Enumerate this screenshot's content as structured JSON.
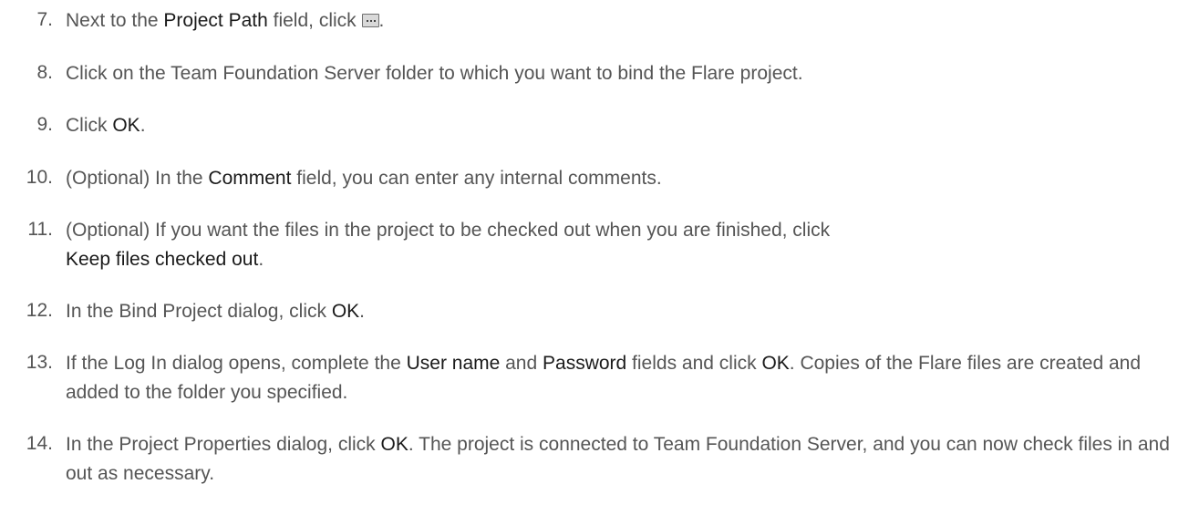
{
  "steps": [
    {
      "number": "7.",
      "parts": [
        {
          "t": "Next to the "
        },
        {
          "t": "Project Path",
          "b": true
        },
        {
          "t": " field, click "
        },
        {
          "icon": "ellipsis-browse-icon"
        },
        {
          "t": "."
        }
      ]
    },
    {
      "number": "8.",
      "parts": [
        {
          "t": "Click on the Team Foundation Server folder to which you want to bind the Flare project."
        }
      ]
    },
    {
      "number": "9.",
      "parts": [
        {
          "t": "Click "
        },
        {
          "t": "OK",
          "b": true
        },
        {
          "t": "."
        }
      ]
    },
    {
      "number": "10.",
      "parts": [
        {
          "t": "(Optional) In the "
        },
        {
          "t": "Comment",
          "b": true
        },
        {
          "t": " field, you can enter any internal comments."
        }
      ]
    },
    {
      "number": "11.",
      "parts": [
        {
          "t": "(Optional) If you want the files in the project to be checked out when you are finished, click "
        },
        {
          "t": "Keep files checked out",
          "b": true
        },
        {
          "t": "."
        }
      ]
    },
    {
      "number": "12.",
      "parts": [
        {
          "t": "In the Bind Project dialog, click "
        },
        {
          "t": "OK",
          "b": true
        },
        {
          "t": "."
        }
      ]
    },
    {
      "number": "13.",
      "parts": [
        {
          "t": "If the Log In dialog opens, complete the "
        },
        {
          "t": "User name",
          "b": true
        },
        {
          "t": " and "
        },
        {
          "t": "Password",
          "b": true
        },
        {
          "t": " fields and click "
        },
        {
          "t": "OK",
          "b": true
        },
        {
          "t": ". Copies of the Flare files are created and added to the folder you specified."
        }
      ]
    },
    {
      "number": "14.",
      "parts": [
        {
          "t": "In the Project Properties dialog, click "
        },
        {
          "t": "OK",
          "b": true
        },
        {
          "t": ". The project is connected to Team Foundation Server, and you can now check files in and out as necessary."
        }
      ]
    }
  ]
}
